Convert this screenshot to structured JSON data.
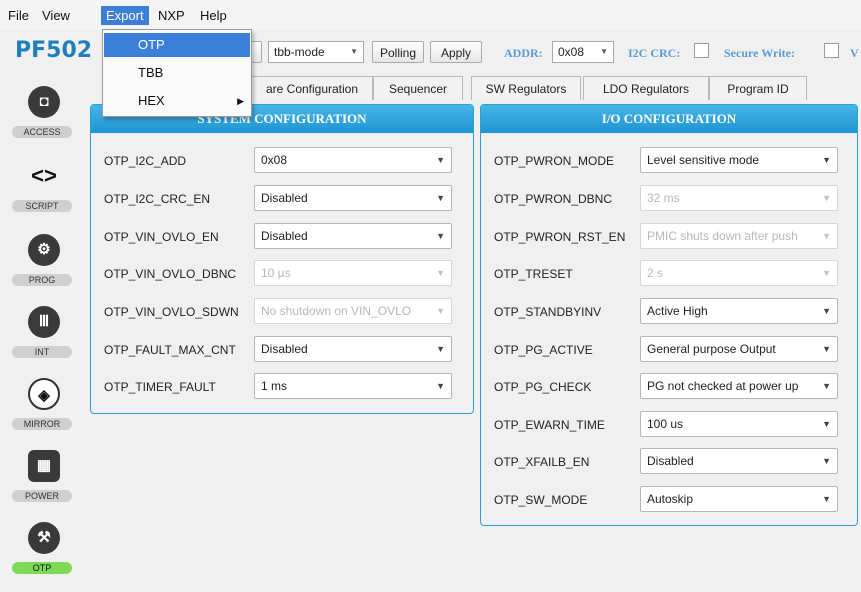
{
  "menubar": {
    "file": "File",
    "view": "View",
    "export": "Export",
    "nxp": "NXP",
    "help": "Help"
  },
  "export_menu": {
    "items": [
      "OTP",
      "TBB",
      "HEX"
    ]
  },
  "toolbar": {
    "app_title": "PF502",
    "mode_value": "tbb-mode",
    "polling_label": "Polling",
    "apply_label": "Apply",
    "addr_label": "ADDR:",
    "addr_value": "0x08",
    "i2c_crc_label": "I2C CRC:",
    "secure_write_label": "Secure Write:",
    "extra_label": "V"
  },
  "sidebar": {
    "items": [
      "ACCESS",
      "SCRIPT",
      "PROG",
      "INT",
      "MIRROR",
      "POWER",
      "OTP"
    ]
  },
  "tabs": [
    "are Configuration",
    "Sequencer",
    "SW Regulators",
    "LDO Regulators",
    "Program ID"
  ],
  "system_config": {
    "title": "SYSTEM CONFIGURATION",
    "rows": [
      {
        "label": "OTP_I2C_ADD",
        "value": "0x08"
      },
      {
        "label": "OTP_I2C_CRC_EN",
        "value": "Disabled"
      },
      {
        "label": "OTP_VIN_OVLO_EN",
        "value": "Disabled"
      },
      {
        "label": "OTP_VIN_OVLO_DBNC",
        "value": "10 µs"
      },
      {
        "label": "OTP_VIN_OVLO_SDWN",
        "value": "No shutdown on VIN_OVLO"
      },
      {
        "label": "OTP_FAULT_MAX_CNT",
        "value": "Disabled"
      },
      {
        "label": "OTP_TIMER_FAULT",
        "value": "1 ms"
      }
    ]
  },
  "io_config": {
    "title": "I/O CONFIGURATION",
    "rows": [
      {
        "label": "OTP_PWRON_MODE",
        "value": "Level sensitive mode"
      },
      {
        "label": "OTP_PWRON_DBNC",
        "value": "32 ms"
      },
      {
        "label": "OTP_PWRON_RST_EN",
        "value": "PMIC shuts down after push"
      },
      {
        "label": "OTP_TRESET",
        "value": "2 s"
      },
      {
        "label": "OTP_STANDBYINV",
        "value": "Active High"
      },
      {
        "label": "OTP_PG_ACTIVE",
        "value": "General purpose Output"
      },
      {
        "label": "OTP_PG_CHECK",
        "value": "PG not checked at power up"
      },
      {
        "label": "OTP_EWARN_TIME",
        "value": "100 us"
      },
      {
        "label": "OTP_XFAILB_EN",
        "value": "Disabled"
      },
      {
        "label": "OTP_SW_MODE",
        "value": "Autoskip"
      }
    ]
  },
  "colors": {
    "accent": "#1f7fbf",
    "panel_header": "#2aa0d8",
    "menu_highlight": "#3c7fd8",
    "active_side": "#7ed957"
  }
}
